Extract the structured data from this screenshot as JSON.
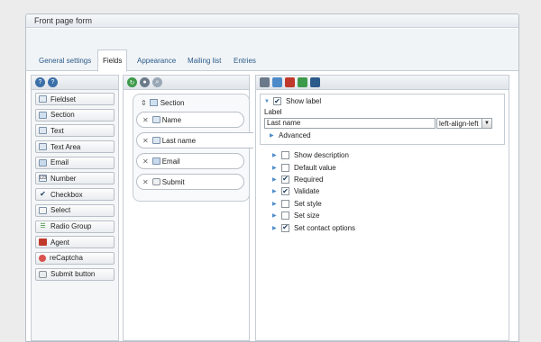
{
  "window": {
    "title": "Front page form"
  },
  "tabs": [
    {
      "label": "General settings"
    },
    {
      "label": "Fields"
    },
    {
      "label": "Appearance"
    },
    {
      "label": "Mailing list"
    },
    {
      "label": "Entries"
    }
  ],
  "palette": {
    "items": [
      {
        "label": "Fieldset",
        "icon": "fieldset-icon"
      },
      {
        "label": "Section",
        "icon": "section-icon"
      },
      {
        "label": "Text",
        "icon": "text-icon"
      },
      {
        "label": "Text Area",
        "icon": "textarea-icon"
      },
      {
        "label": "Email",
        "icon": "email-icon"
      },
      {
        "label": "Number",
        "icon": "number-icon"
      },
      {
        "label": "Checkbox",
        "icon": "checkbox-icon"
      },
      {
        "label": "Select",
        "icon": "select-icon"
      },
      {
        "label": "Radio Group",
        "icon": "radio-group-icon"
      },
      {
        "label": "Agent",
        "icon": "agent-icon"
      },
      {
        "label": "reCaptcha",
        "icon": "recaptcha-icon"
      },
      {
        "label": "Submit button",
        "icon": "submit-icon"
      }
    ]
  },
  "form": {
    "section_label": "Section",
    "fields": [
      {
        "label": "Name"
      },
      {
        "label": "Last name"
      },
      {
        "label": "Email"
      },
      {
        "label": "Submit"
      }
    ]
  },
  "props": {
    "show_label": "Show label",
    "label_heading": "Label",
    "label_value": "Last name",
    "align_value": "left-align-left",
    "advanced": "Advanced",
    "options": [
      {
        "label": "Show description",
        "checked": false
      },
      {
        "label": "Default value",
        "checked": false
      },
      {
        "label": "Required",
        "checked": true
      },
      {
        "label": "Validate",
        "checked": true
      },
      {
        "label": "Set style",
        "checked": false
      },
      {
        "label": "Set size",
        "checked": false
      },
      {
        "label": "Set contact options",
        "checked": true
      }
    ]
  },
  "colors": {
    "link": "#2a5b8a",
    "accent": "#4d8bc8"
  }
}
